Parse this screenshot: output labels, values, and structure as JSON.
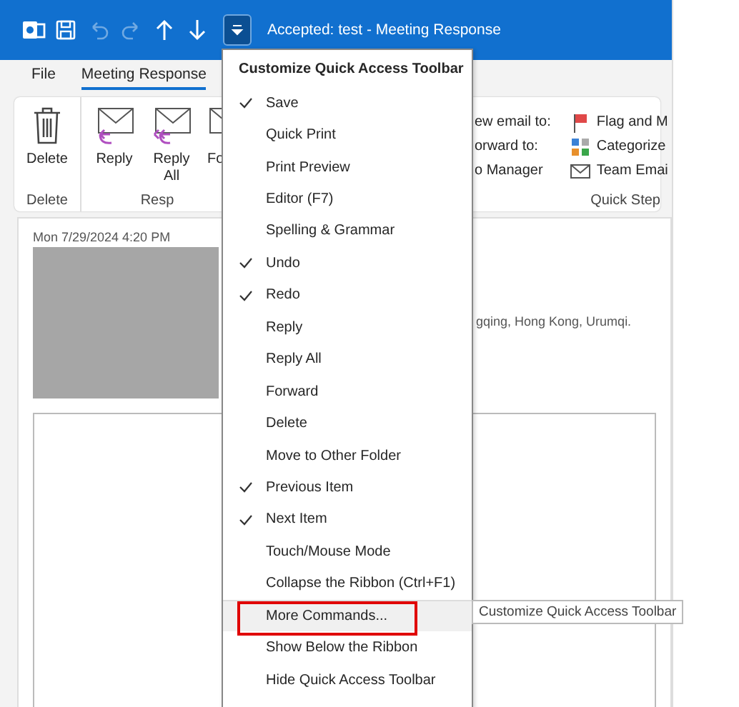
{
  "title_bar": {
    "title": "Accepted: test  -  Meeting Response",
    "quick_access": [
      {
        "kind": "outlook"
      },
      {
        "kind": "save"
      },
      {
        "kind": "undo",
        "disabled": true
      },
      {
        "kind": "redo",
        "disabled": true
      },
      {
        "kind": "up"
      },
      {
        "kind": "down"
      },
      {
        "kind": "customize",
        "selected": true
      }
    ]
  },
  "ribbon_tabs": [
    {
      "label": "File",
      "selected": false
    },
    {
      "label": "Meeting Response",
      "selected": true
    }
  ],
  "ribbon": {
    "groups": [
      {
        "label": "Delete",
        "buttons": [
          {
            "kind": "delete",
            "label": "Delete"
          }
        ]
      },
      {
        "label": "Resp",
        "buttons": [
          {
            "kind": "reply",
            "label": "Reply"
          },
          {
            "kind": "reply-all",
            "label": "Reply All"
          },
          {
            "kind": "forward",
            "label": "Fo"
          }
        ]
      }
    ],
    "quick_steps": {
      "label": "Quick Step",
      "left": [
        "ew email to:",
        "orward to:",
        "o Manager"
      ],
      "right": [
        {
          "kind": "flag",
          "label": "Flag and M"
        },
        {
          "kind": "categorize",
          "label": "Categorize"
        },
        {
          "kind": "mail",
          "label": "Team Emai"
        }
      ]
    }
  },
  "message": {
    "date": "Mon 7/29/2024 4:20 PM",
    "body_fragment": "gqing, Hong Kong, Urumqi."
  },
  "menu": {
    "title": "Customize Quick Access Toolbar",
    "items": [
      {
        "label": "Save",
        "checked": true,
        "selected": false
      },
      {
        "label": "Quick Print",
        "checked": false,
        "selected": false
      },
      {
        "label": "Print Preview",
        "checked": false,
        "selected": false
      },
      {
        "label": "Editor (F7)",
        "checked": false,
        "selected": false
      },
      {
        "label": "Spelling & Grammar",
        "checked": false,
        "selected": false
      },
      {
        "label": "Undo",
        "checked": true,
        "selected": false
      },
      {
        "label": "Redo",
        "checked": true,
        "selected": false
      },
      {
        "label": "Reply",
        "checked": false,
        "selected": false
      },
      {
        "label": "Reply All",
        "checked": false,
        "selected": false
      },
      {
        "label": "Forward",
        "checked": false,
        "selected": false
      },
      {
        "label": "Delete",
        "checked": false,
        "selected": false
      },
      {
        "label": "Move to Other Folder",
        "checked": false,
        "selected": false
      },
      {
        "label": "Previous Item",
        "checked": true,
        "selected": false
      },
      {
        "label": "Next Item",
        "checked": true,
        "selected": false
      },
      {
        "label": "Touch/Mouse Mode",
        "checked": false,
        "selected": false
      },
      {
        "label": "Collapse the Ribbon (Ctrl+F1)",
        "checked": false,
        "selected": false
      },
      {
        "label": "More Commands...",
        "checked": false,
        "selected": true,
        "divider_above": true,
        "annotated": true
      },
      {
        "label": "Show Below the Ribbon",
        "checked": false,
        "selected": false
      },
      {
        "label": "Hide Quick Access Toolbar",
        "checked": false,
        "selected": false
      }
    ]
  },
  "tooltip": {
    "text": "Customize Quick Access Toolbar"
  }
}
